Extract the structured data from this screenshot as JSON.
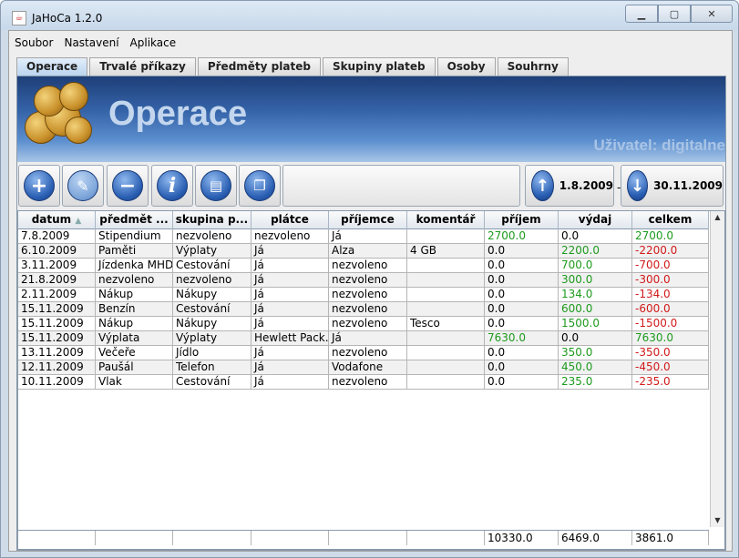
{
  "window": {
    "title": "JaHoCa 1.2.0"
  },
  "menu": [
    "Soubor",
    "Nastavení",
    "Aplikace"
  ],
  "tabs": [
    "Operace",
    "Trvalé příkazy",
    "Předměty plateb",
    "Skupiny plateb",
    "Osoby",
    "Souhrny"
  ],
  "banner": {
    "title": "Operace",
    "user": "Uživatel: digitalne"
  },
  "toolbar": {
    "buttons": [
      "add-icon",
      "edit-icon",
      "remove-icon",
      "info-icon",
      "print-icon",
      "copy-icon"
    ],
    "date_from": "1.8.2009",
    "date_to": "30.11.2009",
    "separator": "-"
  },
  "table": {
    "columns": [
      "datum",
      "předmět ...",
      "skupina p...",
      "plátce",
      "příjemce",
      "komentář",
      "příjem",
      "výdaj",
      "celkem"
    ],
    "rows": [
      [
        "7.8.2009",
        "Stipendium",
        "nezvoleno",
        "nezvoleno",
        "Já",
        "",
        "2700.0",
        "0.0",
        "2700.0"
      ],
      [
        "6.10.2009",
        "Paměti",
        "Výplaty",
        "Já",
        "Alza",
        "4 GB",
        "0.0",
        "2200.0",
        "-2200.0"
      ],
      [
        "3.11.2009",
        "Jízdenka MHD",
        "Cestování",
        "Já",
        "nezvoleno",
        "",
        "0.0",
        "700.0",
        "-700.0"
      ],
      [
        "21.8.2009",
        "nezvoleno",
        "nezvoleno",
        "Já",
        "nezvoleno",
        "",
        "0.0",
        "300.0",
        "-300.0"
      ],
      [
        "2.11.2009",
        "Nákup",
        "Nákupy",
        "Já",
        "nezvoleno",
        "",
        "0.0",
        "134.0",
        "-134.0"
      ],
      [
        "15.11.2009",
        "Benzín",
        "Cestování",
        "Já",
        "nezvoleno",
        "",
        "0.0",
        "600.0",
        "-600.0"
      ],
      [
        "15.11.2009",
        "Nákup",
        "Nákupy",
        "Já",
        "nezvoleno",
        "Tesco",
        "0.0",
        "1500.0",
        "-1500.0"
      ],
      [
        "15.11.2009",
        "Výplata",
        "Výplaty",
        "Hewlett Pack...",
        "Já",
        "",
        "7630.0",
        "0.0",
        "7630.0"
      ],
      [
        "13.11.2009",
        "Večeře",
        "Jídlo",
        "Já",
        "nezvoleno",
        "",
        "0.0",
        "350.0",
        "-350.0"
      ],
      [
        "12.11.2009",
        "Paušál",
        "Telefon",
        "Já",
        "Vodafone",
        "",
        "0.0",
        "450.0",
        "-450.0"
      ],
      [
        "10.11.2009",
        "Vlak",
        "Cestování",
        "Já",
        "nezvoleno",
        "",
        "0.0",
        "235.0",
        "-235.0"
      ]
    ],
    "totals": [
      "",
      "",
      "",
      "",
      "",
      "",
      "10330.0",
      "6469.0",
      "3861.0"
    ]
  },
  "colors": {
    "positive": "#1d9a1d",
    "negative": "#d11a1a",
    "banner": "#3563a8"
  }
}
